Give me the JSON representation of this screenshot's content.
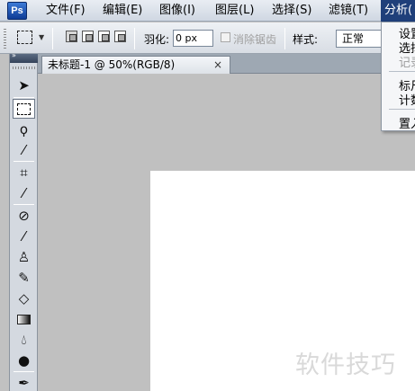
{
  "app": {
    "logo": "Ps"
  },
  "menu": {
    "items": [
      {
        "label": "文件(F)"
      },
      {
        "label": "编辑(E)"
      },
      {
        "label": "图像(I)"
      },
      {
        "label": "图层(L)"
      },
      {
        "label": "选择(S)"
      },
      {
        "label": "滤镜(T)"
      },
      {
        "label": "分析("
      }
    ]
  },
  "analysis_menu": {
    "items": [
      {
        "label": "设置"
      },
      {
        "label": "选择"
      },
      {
        "label": "记录"
      },
      {
        "label": "标尺"
      },
      {
        "label": "计数"
      },
      {
        "label": "置入"
      }
    ]
  },
  "options": {
    "feather_label": "羽化:",
    "feather_value": "0 px",
    "antialias_label": "消除锯齿",
    "style_label": "样式:",
    "style_value": "正常"
  },
  "document": {
    "tab_title": "未标题-1 @ 50%(RGB/8)",
    "close_glyph": "×"
  },
  "tools": [
    "move-tool",
    "rectangular-marquee-tool",
    "lasso-tool",
    "quick-selection-tool",
    "crop-tool",
    "eyedropper-tool",
    "healing-brush-tool",
    "brush-tool",
    "clone-stamp-tool",
    "history-brush-tool",
    "eraser-tool",
    "gradient-tool",
    "blur-tool",
    "dodge-tool",
    "pen-tool"
  ],
  "watermark": "软件技巧",
  "colors": {
    "menu_active": "#1f3f7a",
    "canvas_bg": "#c0c0c0",
    "document_bg": "#ffffff"
  }
}
